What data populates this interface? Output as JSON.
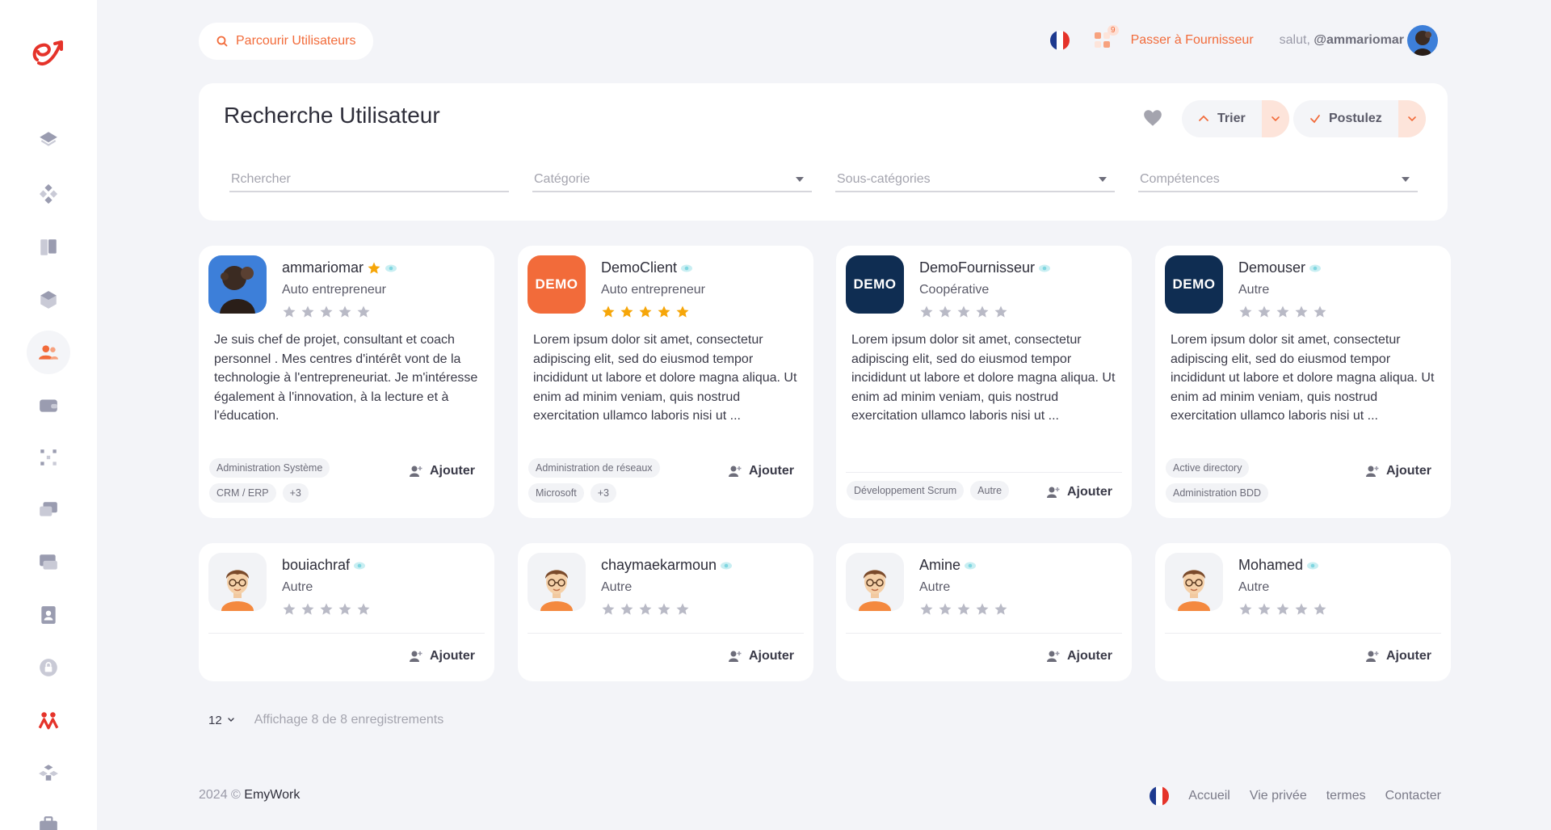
{
  "topbar": {
    "browse_label": "Parcourir Utilisateurs",
    "notif_count": "9",
    "switch_label": "Passer à Fournisseur",
    "greeting_prefix": "salut,",
    "username": "@ammariomar"
  },
  "search": {
    "title": "Recherche Utilisateur",
    "sort_label": "Trier",
    "apply_label": "Postulez",
    "search_placeholder": "Rchercher",
    "category_placeholder": "Catégorie",
    "subcategory_placeholder": "Sous-catégories",
    "skills_placeholder": "Compétences"
  },
  "cards": [
    {
      "name": "ammariomar",
      "role": "Auto entrepreneur",
      "rating": 0,
      "premium": true,
      "desc": "Je suis chef de projet, consultant et coach personnel . Mes centres d'intérêt vont de la technologie à l'entrepreneuriat. Je m'intéresse également à l'innovation, à la lecture et à l'éducation.",
      "tags": [
        "Administration Système",
        "CRM / ERP",
        "+3"
      ],
      "add_label": "Ajouter"
    },
    {
      "name": "DemoClient",
      "role": "Auto entrepreneur",
      "rating": 5,
      "logo_text": "DEMO",
      "desc": "Lorem ipsum dolor sit amet, consectetur adipiscing elit, sed do eiusmod tempor incididunt ut labore et dolore magna aliqua. Ut enim ad minim veniam, quis nostrud exercitation ullamco laboris nisi ut ...",
      "tags": [
        "Administration de réseaux",
        "Microsoft",
        "+3"
      ],
      "add_label": "Ajouter"
    },
    {
      "name": "DemoFournisseur",
      "role": "Coopérative",
      "rating": 0,
      "logo_text": "DEMO",
      "desc": "Lorem ipsum dolor sit amet, consectetur adipiscing elit, sed do eiusmod tempor incididunt ut labore et dolore magna aliqua. Ut enim ad minim veniam, quis nostrud exercitation ullamco laboris nisi ut ...",
      "tags": [
        "Développement Scrum",
        "Autre"
      ],
      "add_label": "Ajouter"
    },
    {
      "name": "Demouser",
      "role": "Autre",
      "rating": 0,
      "logo_text": "DEMO",
      "desc": "Lorem ipsum dolor sit amet, consectetur adipiscing elit, sed do eiusmod tempor incididunt ut labore et dolore magna aliqua. Ut enim ad minim veniam, quis nostrud exercitation ullamco laboris nisi ut ...",
      "tags": [
        "Active directory",
        "Administration BDD"
      ],
      "add_label": "Ajouter"
    },
    {
      "name": "bouiachraf",
      "role": "Autre",
      "rating": 0,
      "add_label": "Ajouter"
    },
    {
      "name": "chaymaekarmoun",
      "role": "Autre",
      "rating": 0,
      "add_label": "Ajouter"
    },
    {
      "name": "Amine",
      "role": "Autre",
      "rating": 0,
      "add_label": "Ajouter"
    },
    {
      "name": "Mohamed",
      "role": "Autre",
      "rating": 0,
      "add_label": "Ajouter"
    }
  ],
  "pager": {
    "per_page": "12",
    "showing": "Affichage 8 de 8 enregistrements"
  },
  "footer": {
    "year": "2024 ©",
    "brand": "EmyWork",
    "links": [
      "Accueil",
      "Vie privée",
      "termes",
      "Contacter"
    ]
  },
  "colors": {
    "accent": "#f26b3a",
    "navy": "#0f2d52",
    "star_on": "#f6a609",
    "star_off": "#b9bac6"
  }
}
